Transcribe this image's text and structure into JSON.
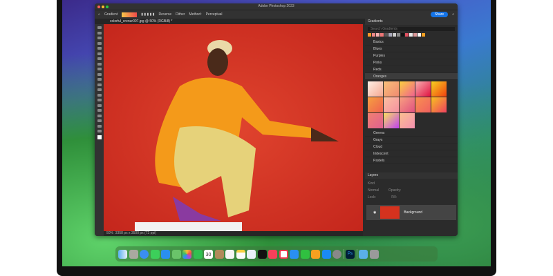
{
  "window": {
    "title": "Adobe Photoshop 2023"
  },
  "options_bar": {
    "tool": "Gradient",
    "reverse": "Reverse",
    "dither": "Dither",
    "method_label": "Method:",
    "method": "Perceptual",
    "share": "Share"
  },
  "document_tab": "colorful_crenur007.jpg @ 50% (RGB/8) *",
  "status": {
    "zoom": "50%",
    "info": "3358 px x 3500 px (72 ppi)"
  },
  "gradients_panel": {
    "title": "Gradients",
    "search_placeholder": "Search Gradients",
    "folders_before": [
      "Basics",
      "Blues",
      "Purples",
      "Pinks",
      "Reds"
    ],
    "open_folder": "Oranges",
    "folders_after": [
      "Greens",
      "Grays",
      "Cloud",
      "Iridescent",
      "Pastels"
    ]
  },
  "layers_panel": {
    "title": "Layers",
    "kind": "Kind",
    "blend": "Normal",
    "opacity": "Opacity:",
    "lock": "Lock:",
    "fill": "Fill:",
    "layer_name": "Background"
  },
  "dock": {
    "apps": [
      "Finder",
      "Launchpad",
      "Safari",
      "Messages",
      "Mail",
      "Maps",
      "Photos",
      "FaceTime",
      "Calendar",
      "Contacts",
      "Reminders",
      "Notes",
      "Freeform",
      "TV",
      "Music",
      "News",
      "Keynote",
      "Numbers",
      "Pages",
      "App Store",
      "System Settings",
      "Photoshop",
      "Downloads",
      "Trash"
    ],
    "calendar_day": "30"
  }
}
